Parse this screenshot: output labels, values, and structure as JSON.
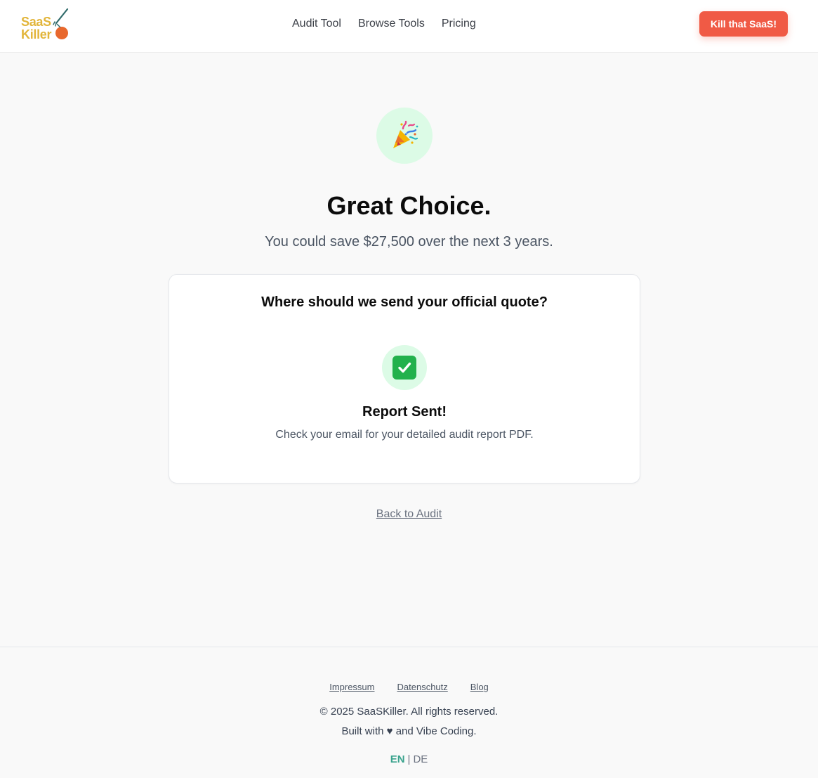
{
  "header": {
    "logo": {
      "line1": "SaaS",
      "line2": "Killer"
    },
    "nav": [
      {
        "label": "Audit Tool"
      },
      {
        "label": "Browse Tools"
      },
      {
        "label": "Pricing"
      }
    ],
    "cta_label": "Kill that SaaS!"
  },
  "hero": {
    "icon": "party-popper-icon",
    "title": "Great Choice.",
    "subtitle": "You could save $27,500 over the next 3 years."
  },
  "card": {
    "question": "Where should we send your official quote?",
    "status_icon": "check-mark-icon",
    "status_title": "Report Sent!",
    "status_text": "Check your email for your detailed audit report PDF."
  },
  "back_link": "Back to Audit",
  "footer": {
    "links": [
      {
        "label": "Impressum"
      },
      {
        "label": "Datenschutz"
      },
      {
        "label": "Blog"
      }
    ],
    "copyright": "© 2025 SaaSKiller. All rights reserved.",
    "built_with": "Built with ♥ and Vibe Coding.",
    "lang": {
      "en": "EN",
      "separator": "|",
      "de": "DE",
      "active": "EN"
    }
  },
  "colors": {
    "accent": "#f05a45",
    "logo_yellow": "#e2b53a",
    "logo_orange": "#e8682d",
    "icon_bg": "#dcfbe6",
    "check_green": "#22b14c",
    "lang_active": "#3aa38d"
  }
}
